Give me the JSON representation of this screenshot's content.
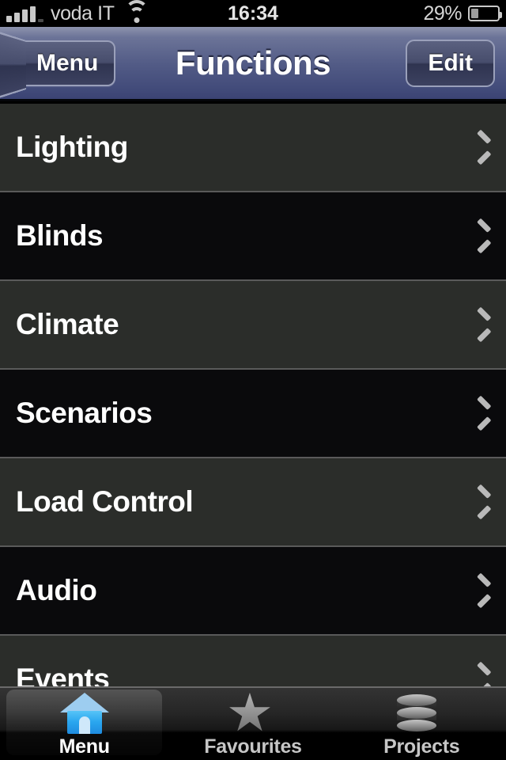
{
  "status_bar": {
    "carrier": "voda IT",
    "time": "16:34",
    "battery_percent": "29%",
    "battery_level": 29,
    "signal_bars": 4,
    "wifi_icon": "wifi-icon",
    "battery_icon": "battery-icon"
  },
  "nav_bar": {
    "back_label": "Menu",
    "title": "Functions",
    "edit_label": "Edit"
  },
  "list": {
    "rows": [
      {
        "label": "Lighting"
      },
      {
        "label": "Blinds"
      },
      {
        "label": "Climate"
      },
      {
        "label": "Scenarios"
      },
      {
        "label": "Load Control"
      },
      {
        "label": "Audio"
      },
      {
        "label": "Events"
      }
    ]
  },
  "tab_bar": {
    "tabs": [
      {
        "label": "Menu",
        "icon": "house-icon",
        "selected": true
      },
      {
        "label": "Favourites",
        "icon": "star-icon",
        "selected": false
      },
      {
        "label": "Projects",
        "icon": "database-icon",
        "selected": false
      }
    ]
  },
  "colors": {
    "nav_bar_top": "#8e94ae",
    "nav_bar_bottom": "#3b4373",
    "row_odd": "#2b2d2a",
    "row_even": "#0a0a0c",
    "separator": "#5a5a5a",
    "accent_blue": "#2aa6ef",
    "text_primary": "#ffffff",
    "text_muted": "#c6c6c6"
  }
}
